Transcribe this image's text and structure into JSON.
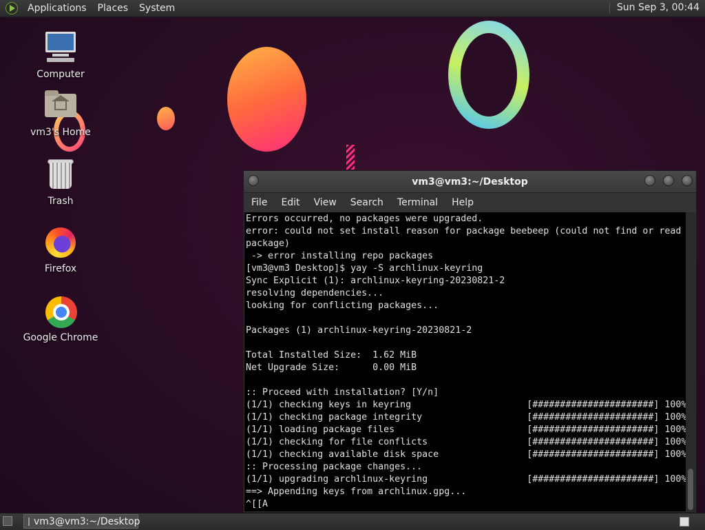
{
  "top_panel": {
    "menus": [
      "Applications",
      "Places",
      "System"
    ],
    "clock": "Sun Sep  3, 00:44"
  },
  "desktop_icons": [
    {
      "label": "Computer",
      "icon": "computer-icon"
    },
    {
      "label": "vm3's Home",
      "icon": "home-folder-icon"
    },
    {
      "label": "Trash",
      "icon": "trash-icon"
    },
    {
      "label": "Firefox",
      "icon": "firefox-icon"
    },
    {
      "label": "Google Chrome",
      "icon": "chrome-icon"
    }
  ],
  "terminal": {
    "title": "vm3@vm3:~/Desktop",
    "menu": [
      "File",
      "Edit",
      "View",
      "Search",
      "Terminal",
      "Help"
    ],
    "lines": [
      "Errors occurred, no packages were upgraded.",
      "error: could not set install reason for package beebeep (could not find or read",
      "package)",
      " -> error installing repo packages",
      "[vm3@vm3 Desktop]$ yay -S archlinux-keyring",
      "Sync Explicit (1): archlinux-keyring-20230821-2",
      "resolving dependencies...",
      "looking for conflicting packages...",
      "",
      "Packages (1) archlinux-keyring-20230821-2",
      "",
      "Total Installed Size:  1.62 MiB",
      "Net Upgrade Size:      0.00 MiB",
      "",
      ":: Proceed with installation? [Y/n]",
      "(1/1) checking keys in keyring                     [######################] 100%",
      "(1/1) checking package integrity                   [######################] 100%",
      "(1/1) loading package files                        [######################] 100%",
      "(1/1) checking for file conflicts                  [######################] 100%",
      "(1/1) checking available disk space                [######################] 100%",
      ":: Processing package changes...",
      "(1/1) upgrading archlinux-keyring                  [######################] 100%",
      "==> Appending keys from archlinux.gpg...",
      "^[[A"
    ]
  },
  "bottom_panel": {
    "taskbar_item": "vm3@vm3:~/Desktop"
  }
}
